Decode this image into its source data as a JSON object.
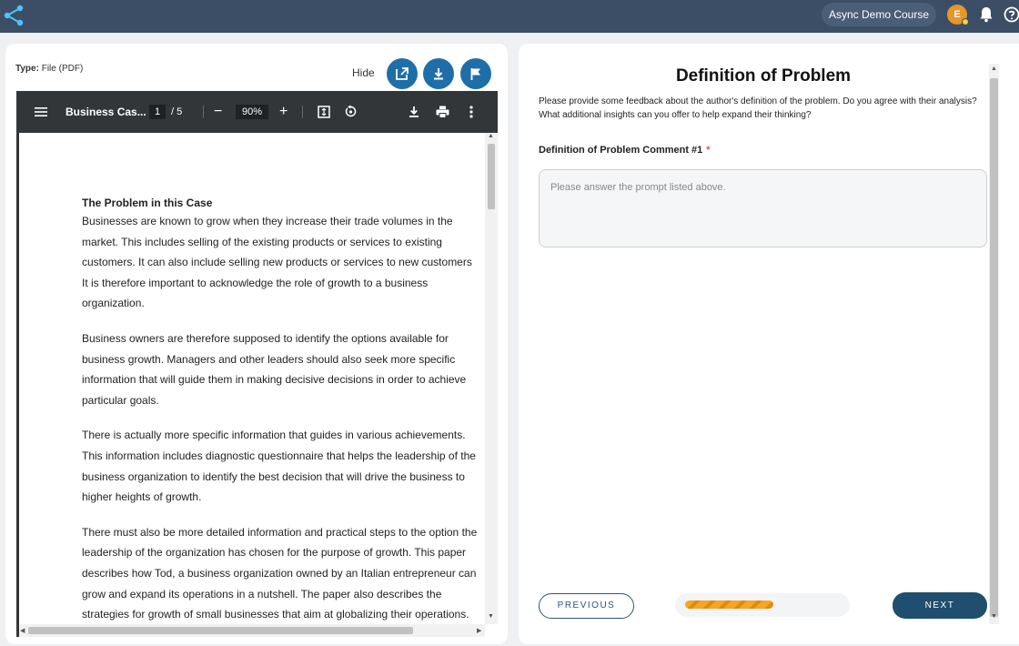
{
  "topbar": {
    "course": "Async Demo Course",
    "avatar_initial": "E"
  },
  "left": {
    "type_label": "Type:",
    "type_value": "File (PDF)",
    "hide": "Hide",
    "viewer": {
      "filename": "Business Cas...",
      "page_current": "1",
      "page_total": "/ 5",
      "zoom": "90%",
      "zoom_out": "−",
      "zoom_in": "+"
    },
    "document": {
      "heading": "The Problem in this Case",
      "paragraphs": [
        [
          "Businesses are known to grow when they increase their trade volumes in the",
          "market. This includes selling of the existing products or services to existing",
          "customers. It can also include selling new products or services to new customers",
          "It is therefore important to acknowledge the role of growth to a business",
          "organization."
        ],
        [
          "Business owners are therefore supposed to identify the options available for",
          "business growth. Managers and other leaders should also seek more specific",
          "information that will guide them in making decisive decisions in order to achieve",
          "particular goals."
        ],
        [
          "There is actually more specific information that guides in various achievements.",
          "This information includes diagnostic questionnaire that helps the leadership of the",
          "business organization to identify the best decision that will drive the business to",
          "higher heights of growth."
        ],
        [
          "There must also be more detailed information and practical steps to the option the",
          "leadership of the organization has chosen for the purpose of growth. This paper",
          "describes how Tod, a business organization owned by an Italian entrepreneur can",
          "grow and expand its operations in a nutshell. The paper also describes the",
          "strategies for growth of small businesses that aim at globalizing their operations."
        ]
      ]
    }
  },
  "right": {
    "title": "Definition of Problem",
    "description_line1": "Please provide some feedback about the author's definition of the problem. Do you agree with their analysis?",
    "description_line2": "What additional insights can you offer to help expand their thinking?",
    "field_label": "Definition of Problem Comment #1",
    "required_mark": "*",
    "placeholder": "Please answer the prompt listed above.",
    "previous": "PREVIOUS",
    "next": "NEXT",
    "progress_fraction": 0.57
  },
  "colors": {
    "topbar": "#3b4e66",
    "accent_blue": "#1e6fa8",
    "next_button": "#1f4e6e",
    "progress": "#f5a623",
    "required": "#d9534f"
  }
}
